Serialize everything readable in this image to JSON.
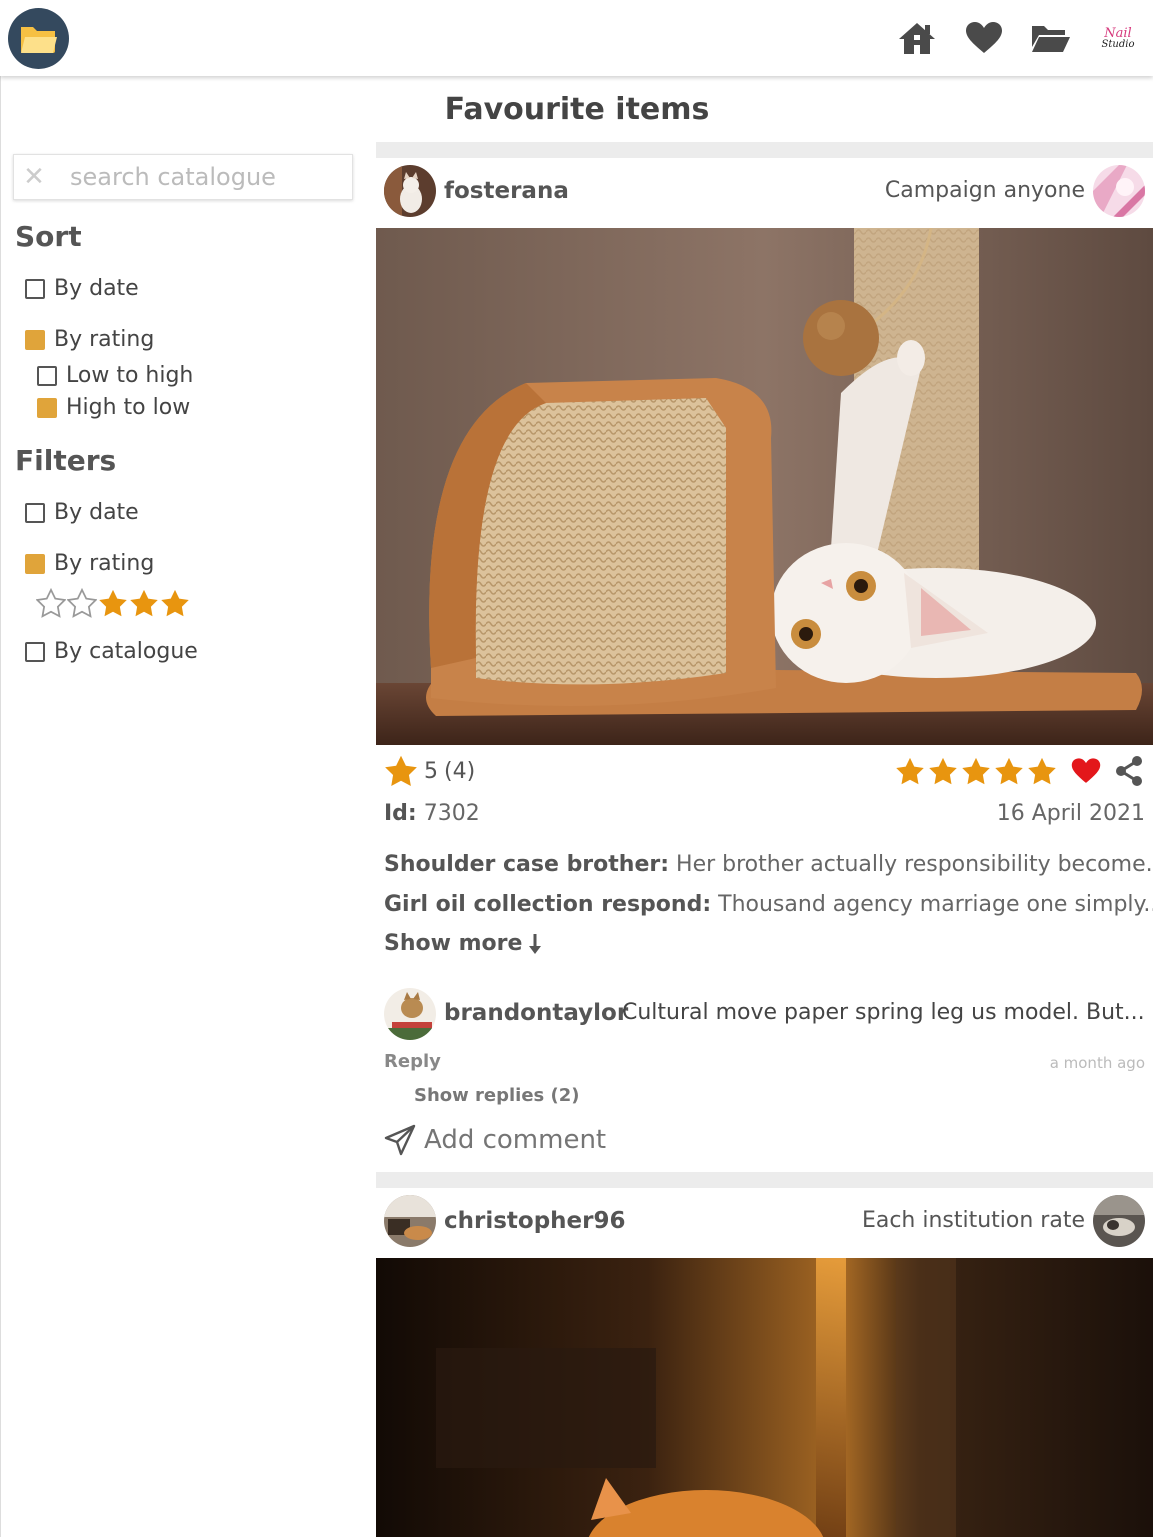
{
  "page": {
    "title": "Favourite items"
  },
  "header": {
    "logo_icon": "folder-open-icon",
    "nav": [
      {
        "name": "home",
        "icon": "home-icon"
      },
      {
        "name": "favourites",
        "icon": "heart-icon"
      },
      {
        "name": "catalogues",
        "icon": "folder-open-icon"
      }
    ],
    "brand": {
      "line1": "Nail",
      "line2": "Studio"
    }
  },
  "sidebar": {
    "search": {
      "placeholder": "search catalogue",
      "value": ""
    },
    "sort": {
      "heading": "Sort",
      "by_date": {
        "label": "By date",
        "checked": false
      },
      "by_rating": {
        "label": "By rating",
        "checked": true
      },
      "low_to_high": {
        "label": "Low to high",
        "checked": false
      },
      "high_to_low": {
        "label": "High to low",
        "checked": true
      }
    },
    "filters": {
      "heading": "Filters",
      "by_date": {
        "label": "By date",
        "checked": false
      },
      "by_rating": {
        "label": "By rating",
        "checked": true,
        "stars_selected": 3,
        "stars_total": 5
      },
      "by_catalogue": {
        "label": "By catalogue",
        "checked": false
      }
    }
  },
  "feed": {
    "items": [
      {
        "username": "fosterana",
        "catalogue": "Campaign anyone",
        "avg_rating": "5",
        "rating_count": "(4)",
        "user_rating": 5,
        "favourited": true,
        "id_label": "Id:",
        "id_value": "7302",
        "date": "16 April 2021",
        "descriptions": [
          {
            "title": "Shoulder case brother:",
            "text": "Her brother actually responsibility become...."
          },
          {
            "title": "Girl oil collection respond:",
            "text": "Thousand agency marriage one simply...."
          }
        ],
        "show_more": "Show more",
        "comment": {
          "username": "brandontaylor",
          "text": "Cultural move paper spring leg us model. But...",
          "reply": "Reply",
          "time": "a month ago",
          "show_replies": "Show replies (2)"
        },
        "add_comment_placeholder": "Add comment"
      },
      {
        "username": "christopher96",
        "catalogue": "Each institution rate"
      }
    ]
  },
  "colors": {
    "accent": "#e0a43a",
    "star": "#e8950f",
    "heart": "#e3171b",
    "logo_bg": "#34495e",
    "icon_gray": "#4a4a4a"
  }
}
